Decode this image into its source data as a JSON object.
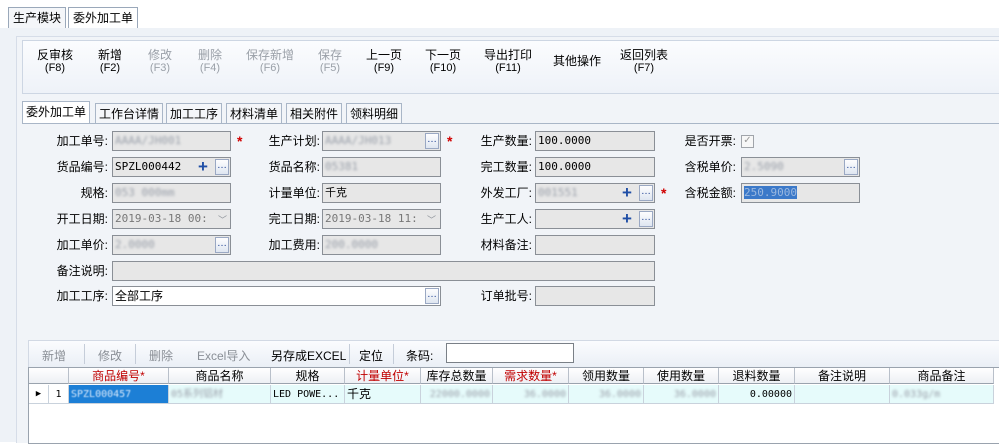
{
  "module_tabs": [
    "生产模块",
    "委外加工单"
  ],
  "toolbar": [
    {
      "label": "反审核",
      "key": "(F8)",
      "enabled": true
    },
    {
      "label": "新增",
      "key": "(F2)",
      "enabled": true
    },
    {
      "label": "修改",
      "key": "(F3)",
      "enabled": false
    },
    {
      "label": "删除",
      "key": "(F4)",
      "enabled": false
    },
    {
      "label": "保存新增",
      "key": "(F6)",
      "enabled": false
    },
    {
      "label": "保存",
      "key": "(F5)",
      "enabled": false
    },
    {
      "label": "上一页",
      "key": "(F9)",
      "enabled": true
    },
    {
      "label": "下一页",
      "key": "(F10)",
      "enabled": true
    },
    {
      "label": "导出打印",
      "key": "(F11)",
      "enabled": true
    },
    {
      "label": "其他操作",
      "key": "",
      "enabled": true
    },
    {
      "label": "返回列表",
      "key": "(F7)",
      "enabled": true
    }
  ],
  "detail_tabs": [
    "委外加工单",
    "工作台详情",
    "加工工序",
    "材料清单",
    "相关附件",
    "领料明细"
  ],
  "form": {
    "order_no": {
      "label": "加工单号:",
      "value": "AAAA/JH001"
    },
    "plan": {
      "label": "生产计划:",
      "value": "AAAA/JH013"
    },
    "qty": {
      "label": "生产数量:",
      "value": "100.0000"
    },
    "invoiced": {
      "label": "是否开票:",
      "value": "✓"
    },
    "goods_code": {
      "label": "货品编号:",
      "value": "SPZL000442"
    },
    "goods_name": {
      "label": "货品名称:",
      "value": "05381"
    },
    "done_qty": {
      "label": "完工数量:",
      "value": "100.0000"
    },
    "tax_price": {
      "label": "含税单价:",
      "value": "2.5090"
    },
    "spec": {
      "label": "规格:",
      "value": "053 000mm"
    },
    "unit": {
      "label": "计量单位:",
      "value": "千克"
    },
    "factory": {
      "label": "外发工厂:",
      "value": "001551"
    },
    "tax_amount": {
      "label": "含税金额:",
      "value": "250.9000"
    },
    "start_date": {
      "label": "开工日期:",
      "value": "2019-03-18 00:"
    },
    "end_date": {
      "label": "完工日期:",
      "value": "2019-03-18 11:"
    },
    "worker": {
      "label": "生产工人:",
      "value": ""
    },
    "unit_price": {
      "label": "加工单价:",
      "value": "2.0000"
    },
    "cost": {
      "label": "加工费用:",
      "value": "200.0000"
    },
    "material_note": {
      "label": "材料备注:",
      "value": ""
    },
    "remark": {
      "label": "备注说明:",
      "value": ""
    },
    "process": {
      "label": "加工工序:",
      "value": "全部工序"
    },
    "batch": {
      "label": "订单批号:",
      "value": ""
    }
  },
  "grid_toolbar": {
    "add": "新增",
    "edit": "修改",
    "delete": "删除",
    "excel_import": "Excel导入",
    "save_excel": "另存成EXCEL",
    "locate": "定位",
    "barcode_label": "条码:",
    "barcode_value": ""
  },
  "grid": {
    "columns": [
      "商品编号*",
      "商品名称",
      "规格",
      "计量单位*",
      "库存总数量",
      "需求数量*",
      "领用数量",
      "使用数量",
      "退料数量",
      "备注说明",
      "商品备注"
    ],
    "required_color": "#c00000",
    "rows": [
      {
        "row_no": "1",
        "marker": "▶",
        "code": "SPZL000457",
        "name": "05系列铝材",
        "spec": "LED POWE...",
        "unit": "千克",
        "stock": "22000.0000",
        "demand": "36.0000",
        "used": "36.0000",
        "consumed": "36.0000",
        "returned": "0.00000",
        "remark": "",
        "goods_remark": "0.033g/m"
      }
    ]
  }
}
